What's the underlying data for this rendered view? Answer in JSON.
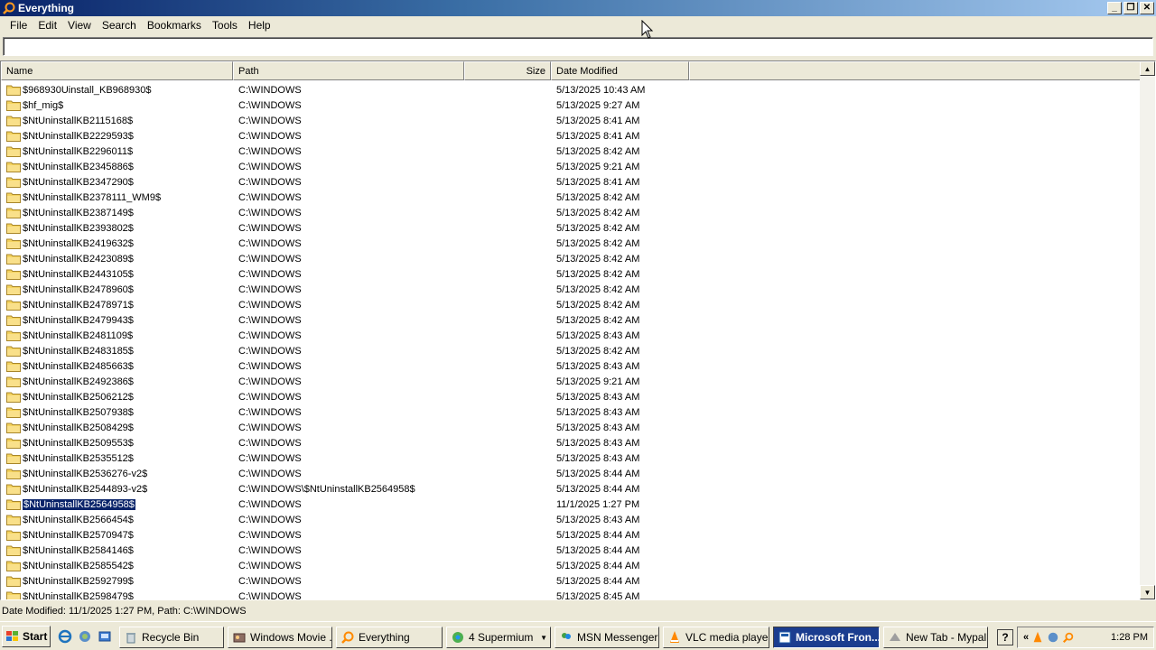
{
  "window": {
    "title": "Everything"
  },
  "menu": [
    "File",
    "Edit",
    "View",
    "Search",
    "Bookmarks",
    "Tools",
    "Help"
  ],
  "search": {
    "value": ""
  },
  "columns": {
    "name": "Name",
    "path": "Path",
    "size": "Size",
    "date": "Date Modified"
  },
  "rows": [
    {
      "name": "$968930Uinstall_KB968930$",
      "path": "C:\\WINDOWS",
      "size": "",
      "date": "5/13/2025 10:43 AM"
    },
    {
      "name": "$hf_mig$",
      "path": "C:\\WINDOWS",
      "size": "",
      "date": "5/13/2025 9:27 AM"
    },
    {
      "name": "$NtUninstallKB2115168$",
      "path": "C:\\WINDOWS",
      "size": "",
      "date": "5/13/2025 8:41 AM"
    },
    {
      "name": "$NtUninstallKB2229593$",
      "path": "C:\\WINDOWS",
      "size": "",
      "date": "5/13/2025 8:41 AM"
    },
    {
      "name": "$NtUninstallKB2296011$",
      "path": "C:\\WINDOWS",
      "size": "",
      "date": "5/13/2025 8:42 AM"
    },
    {
      "name": "$NtUninstallKB2345886$",
      "path": "C:\\WINDOWS",
      "size": "",
      "date": "5/13/2025 9:21 AM"
    },
    {
      "name": "$NtUninstallKB2347290$",
      "path": "C:\\WINDOWS",
      "size": "",
      "date": "5/13/2025 8:41 AM"
    },
    {
      "name": "$NtUninstallKB2378111_WM9$",
      "path": "C:\\WINDOWS",
      "size": "",
      "date": "5/13/2025 8:42 AM"
    },
    {
      "name": "$NtUninstallKB2387149$",
      "path": "C:\\WINDOWS",
      "size": "",
      "date": "5/13/2025 8:42 AM"
    },
    {
      "name": "$NtUninstallKB2393802$",
      "path": "C:\\WINDOWS",
      "size": "",
      "date": "5/13/2025 8:42 AM"
    },
    {
      "name": "$NtUninstallKB2419632$",
      "path": "C:\\WINDOWS",
      "size": "",
      "date": "5/13/2025 8:42 AM"
    },
    {
      "name": "$NtUninstallKB2423089$",
      "path": "C:\\WINDOWS",
      "size": "",
      "date": "5/13/2025 8:42 AM"
    },
    {
      "name": "$NtUninstallKB2443105$",
      "path": "C:\\WINDOWS",
      "size": "",
      "date": "5/13/2025 8:42 AM"
    },
    {
      "name": "$NtUninstallKB2478960$",
      "path": "C:\\WINDOWS",
      "size": "",
      "date": "5/13/2025 8:42 AM"
    },
    {
      "name": "$NtUninstallKB2478971$",
      "path": "C:\\WINDOWS",
      "size": "",
      "date": "5/13/2025 8:42 AM"
    },
    {
      "name": "$NtUninstallKB2479943$",
      "path": "C:\\WINDOWS",
      "size": "",
      "date": "5/13/2025 8:42 AM"
    },
    {
      "name": "$NtUninstallKB2481109$",
      "path": "C:\\WINDOWS",
      "size": "",
      "date": "5/13/2025 8:43 AM"
    },
    {
      "name": "$NtUninstallKB2483185$",
      "path": "C:\\WINDOWS",
      "size": "",
      "date": "5/13/2025 8:42 AM"
    },
    {
      "name": "$NtUninstallKB2485663$",
      "path": "C:\\WINDOWS",
      "size": "",
      "date": "5/13/2025 8:43 AM"
    },
    {
      "name": "$NtUninstallKB2492386$",
      "path": "C:\\WINDOWS",
      "size": "",
      "date": "5/13/2025 9:21 AM"
    },
    {
      "name": "$NtUninstallKB2506212$",
      "path": "C:\\WINDOWS",
      "size": "",
      "date": "5/13/2025 8:43 AM"
    },
    {
      "name": "$NtUninstallKB2507938$",
      "path": "C:\\WINDOWS",
      "size": "",
      "date": "5/13/2025 8:43 AM"
    },
    {
      "name": "$NtUninstallKB2508429$",
      "path": "C:\\WINDOWS",
      "size": "",
      "date": "5/13/2025 8:43 AM"
    },
    {
      "name": "$NtUninstallKB2509553$",
      "path": "C:\\WINDOWS",
      "size": "",
      "date": "5/13/2025 8:43 AM"
    },
    {
      "name": "$NtUninstallKB2535512$",
      "path": "C:\\WINDOWS",
      "size": "",
      "date": "5/13/2025 8:43 AM"
    },
    {
      "name": "$NtUninstallKB2536276-v2$",
      "path": "C:\\WINDOWS",
      "size": "",
      "date": "5/13/2025 8:44 AM"
    },
    {
      "name": "$NtUninstallKB2544893-v2$",
      "path": "C:\\WINDOWS\\$NtUninstallKB2564958$",
      "size": "",
      "date": "5/13/2025 8:44 AM"
    },
    {
      "name": "$NtUninstallKB2564958$",
      "path": "C:\\WINDOWS",
      "size": "",
      "date": "11/1/2025 1:27 PM",
      "selected": true
    },
    {
      "name": "$NtUninstallKB2566454$",
      "path": "C:\\WINDOWS",
      "size": "",
      "date": "5/13/2025 8:43 AM"
    },
    {
      "name": "$NtUninstallKB2570947$",
      "path": "C:\\WINDOWS",
      "size": "",
      "date": "5/13/2025 8:44 AM"
    },
    {
      "name": "$NtUninstallKB2584146$",
      "path": "C:\\WINDOWS",
      "size": "",
      "date": "5/13/2025 8:44 AM"
    },
    {
      "name": "$NtUninstallKB2585542$",
      "path": "C:\\WINDOWS",
      "size": "",
      "date": "5/13/2025 8:44 AM"
    },
    {
      "name": "$NtUninstallKB2592799$",
      "path": "C:\\WINDOWS",
      "size": "",
      "date": "5/13/2025 8:44 AM"
    },
    {
      "name": "$NtUninstallKB2598479$",
      "path": "C:\\WINDOWS",
      "size": "",
      "date": "5/13/2025 8:45 AM"
    }
  ],
  "status": "Date Modified: 11/1/2025 1:27 PM, Path: C:\\WINDOWS",
  "taskbar": {
    "start": "Start",
    "tasks": [
      {
        "label": "Recycle Bin",
        "icon": "recycle-bin-icon"
      },
      {
        "label": "Windows Movie ...",
        "icon": "movie-icon"
      },
      {
        "label": "Everything",
        "icon": "everything-icon"
      },
      {
        "label": "4 Supermium",
        "icon": "browser-icon",
        "dropdown": true
      },
      {
        "label": "MSN Messenger",
        "icon": "msn-icon"
      },
      {
        "label": "VLC media player",
        "icon": "vlc-icon"
      },
      {
        "label": "Microsoft Fron...",
        "icon": "frontpage-icon",
        "active": true
      },
      {
        "label": "New Tab - Mypal",
        "icon": "mypal-icon"
      }
    ],
    "clock": "1:28 PM"
  },
  "colors": {
    "title_start": "#0a246a",
    "title_end": "#a6caf0",
    "selection": "#0a246a",
    "folder": "#f4d35e"
  }
}
